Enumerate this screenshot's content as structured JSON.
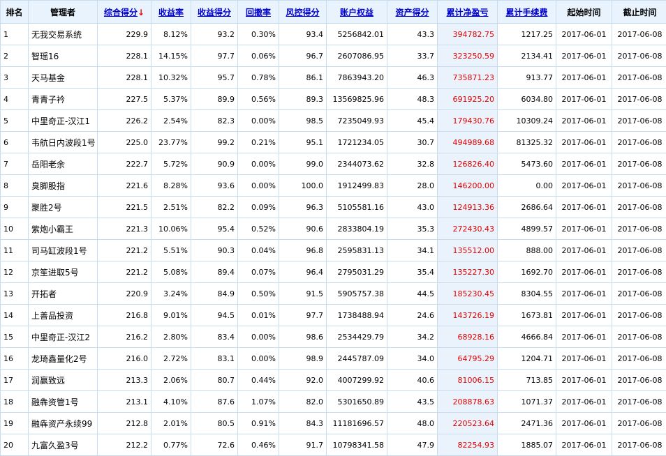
{
  "headers": {
    "rank": "排名",
    "manager": "管理者",
    "composite": "综合得分",
    "composite_arrow": "↓",
    "return_rate": "收益率",
    "return_score": "收益得分",
    "drawdown": "回撤率",
    "risk_score": "风控得分",
    "equity": "账户权益",
    "asset_score": "资产得分",
    "net_pnl": "累计净盈亏",
    "fees": "累计手续费",
    "start": "起始时间",
    "end": "截止时间"
  },
  "accent": {
    "link": "#0000cc",
    "pnl": "#e00000",
    "header_bg": "#e9f3fd",
    "border": "#c8dcf0"
  },
  "rows": [
    {
      "rank": "1",
      "manager": "无我交易系统",
      "composite": "229.9",
      "return_rate": "8.12%",
      "return_score": "93.2",
      "drawdown": "0.30%",
      "risk_score": "93.4",
      "equity": "5256842.01",
      "asset_score": "43.3",
      "net_pnl": "394782.75",
      "fees": "1217.25",
      "start": "2017-06-01",
      "end": "2017-06-08"
    },
    {
      "rank": "2",
      "manager": "智瑶16",
      "composite": "228.1",
      "return_rate": "14.15%",
      "return_score": "97.7",
      "drawdown": "0.06%",
      "risk_score": "96.7",
      "equity": "2607086.95",
      "asset_score": "33.7",
      "net_pnl": "323250.59",
      "fees": "2134.41",
      "start": "2017-06-01",
      "end": "2017-06-08"
    },
    {
      "rank": "3",
      "manager": "天马基金",
      "composite": "228.1",
      "return_rate": "10.32%",
      "return_score": "95.7",
      "drawdown": "0.78%",
      "risk_score": "86.1",
      "equity": "7863943.20",
      "asset_score": "46.3",
      "net_pnl": "735871.23",
      "fees": "913.77",
      "start": "2017-06-01",
      "end": "2017-06-08"
    },
    {
      "rank": "4",
      "manager": "青青子衿",
      "composite": "227.5",
      "return_rate": "5.37%",
      "return_score": "89.9",
      "drawdown": "0.56%",
      "risk_score": "89.3",
      "equity": "13569825.96",
      "asset_score": "48.3",
      "net_pnl": "691925.20",
      "fees": "6034.80",
      "start": "2017-06-01",
      "end": "2017-06-08"
    },
    {
      "rank": "5",
      "manager": "中里奇正-汉江1",
      "composite": "226.2",
      "return_rate": "2.54%",
      "return_score": "82.3",
      "drawdown": "0.00%",
      "risk_score": "98.5",
      "equity": "7235049.93",
      "asset_score": "45.4",
      "net_pnl": "179430.76",
      "fees": "10309.24",
      "start": "2017-06-01",
      "end": "2017-06-08"
    },
    {
      "rank": "6",
      "manager": "韦航日内波段1号",
      "composite": "225.0",
      "return_rate": "23.77%",
      "return_score": "99.2",
      "drawdown": "0.21%",
      "risk_score": "95.1",
      "equity": "1721234.05",
      "asset_score": "30.7",
      "net_pnl": "494989.68",
      "fees": "81325.32",
      "start": "2017-06-01",
      "end": "2017-06-08"
    },
    {
      "rank": "7",
      "manager": "岳阳老余",
      "composite": "222.7",
      "return_rate": "5.72%",
      "return_score": "90.9",
      "drawdown": "0.00%",
      "risk_score": "99.0",
      "equity": "2344073.62",
      "asset_score": "32.8",
      "net_pnl": "126826.40",
      "fees": "5473.60",
      "start": "2017-06-01",
      "end": "2017-06-08"
    },
    {
      "rank": "8",
      "manager": "臭脚股指",
      "composite": "221.6",
      "return_rate": "8.28%",
      "return_score": "93.6",
      "drawdown": "0.00%",
      "risk_score": "100.0",
      "equity": "1912499.83",
      "asset_score": "28.0",
      "net_pnl": "146200.00",
      "fees": "0.00",
      "start": "2017-06-01",
      "end": "2017-06-08"
    },
    {
      "rank": "9",
      "manager": "聚胜2号",
      "composite": "221.5",
      "return_rate": "2.51%",
      "return_score": "82.2",
      "drawdown": "0.09%",
      "risk_score": "96.3",
      "equity": "5105581.16",
      "asset_score": "43.0",
      "net_pnl": "124913.36",
      "fees": "2686.64",
      "start": "2017-06-01",
      "end": "2017-06-08"
    },
    {
      "rank": "10",
      "manager": "紫炮小霸王",
      "composite": "221.3",
      "return_rate": "10.06%",
      "return_score": "95.4",
      "drawdown": "0.52%",
      "risk_score": "90.6",
      "equity": "2833804.19",
      "asset_score": "35.3",
      "net_pnl": "272430.43",
      "fees": "4899.57",
      "start": "2017-06-01",
      "end": "2017-06-08"
    },
    {
      "rank": "11",
      "manager": "司马缸波段1号",
      "composite": "221.2",
      "return_rate": "5.51%",
      "return_score": "90.3",
      "drawdown": "0.04%",
      "risk_score": "96.8",
      "equity": "2595831.13",
      "asset_score": "34.1",
      "net_pnl": "135512.00",
      "fees": "888.00",
      "start": "2017-06-01",
      "end": "2017-06-08"
    },
    {
      "rank": "12",
      "manager": "京笙进取5号",
      "composite": "221.2",
      "return_rate": "5.08%",
      "return_score": "89.4",
      "drawdown": "0.07%",
      "risk_score": "96.4",
      "equity": "2795031.29",
      "asset_score": "35.4",
      "net_pnl": "135227.30",
      "fees": "1692.70",
      "start": "2017-06-01",
      "end": "2017-06-08"
    },
    {
      "rank": "13",
      "manager": "开拓者",
      "composite": "220.9",
      "return_rate": "3.24%",
      "return_score": "84.9",
      "drawdown": "0.50%",
      "risk_score": "91.5",
      "equity": "5905757.38",
      "asset_score": "44.5",
      "net_pnl": "185230.45",
      "fees": "8304.55",
      "start": "2017-06-01",
      "end": "2017-06-08"
    },
    {
      "rank": "14",
      "manager": "上善品投资",
      "composite": "216.8",
      "return_rate": "9.01%",
      "return_score": "94.5",
      "drawdown": "0.01%",
      "risk_score": "97.7",
      "equity": "1738488.94",
      "asset_score": "24.6",
      "net_pnl": "143726.19",
      "fees": "1673.81",
      "start": "2017-06-01",
      "end": "2017-06-08"
    },
    {
      "rank": "15",
      "manager": "中里奇正-汉江2",
      "composite": "216.2",
      "return_rate": "2.80%",
      "return_score": "83.4",
      "drawdown": "0.00%",
      "risk_score": "98.6",
      "equity": "2534429.79",
      "asset_score": "34.2",
      "net_pnl": "68928.16",
      "fees": "4666.84",
      "start": "2017-06-01",
      "end": "2017-06-08"
    },
    {
      "rank": "16",
      "manager": "龙琦鑫量化2号",
      "composite": "216.0",
      "return_rate": "2.72%",
      "return_score": "83.1",
      "drawdown": "0.00%",
      "risk_score": "98.9",
      "equity": "2445787.09",
      "asset_score": "34.0",
      "net_pnl": "64795.29",
      "fees": "1204.71",
      "start": "2017-06-01",
      "end": "2017-06-08"
    },
    {
      "rank": "17",
      "manager": "润赢致远",
      "composite": "213.3",
      "return_rate": "2.06%",
      "return_score": "80.7",
      "drawdown": "0.44%",
      "risk_score": "92.0",
      "equity": "4007299.92",
      "asset_score": "40.6",
      "net_pnl": "81006.15",
      "fees": "713.85",
      "start": "2017-06-01",
      "end": "2017-06-08"
    },
    {
      "rank": "18",
      "manager": "融犇资管1号",
      "composite": "213.1",
      "return_rate": "4.10%",
      "return_score": "87.6",
      "drawdown": "1.07%",
      "risk_score": "82.0",
      "equity": "5301650.89",
      "asset_score": "43.5",
      "net_pnl": "208878.63",
      "fees": "1071.37",
      "start": "2017-06-01",
      "end": "2017-06-08"
    },
    {
      "rank": "19",
      "manager": "融犇资产永续99",
      "composite": "212.8",
      "return_rate": "2.01%",
      "return_score": "80.5",
      "drawdown": "0.91%",
      "risk_score": "84.3",
      "equity": "11181696.57",
      "asset_score": "48.0",
      "net_pnl": "220523.64",
      "fees": "2471.36",
      "start": "2017-06-01",
      "end": "2017-06-08"
    },
    {
      "rank": "20",
      "manager": "九富久盈3号",
      "composite": "212.2",
      "return_rate": "0.77%",
      "return_score": "72.6",
      "drawdown": "0.46%",
      "risk_score": "91.7",
      "equity": "10798341.58",
      "asset_score": "47.9",
      "net_pnl": "82254.93",
      "fees": "1885.07",
      "start": "2017-06-01",
      "end": "2017-06-08"
    }
  ]
}
